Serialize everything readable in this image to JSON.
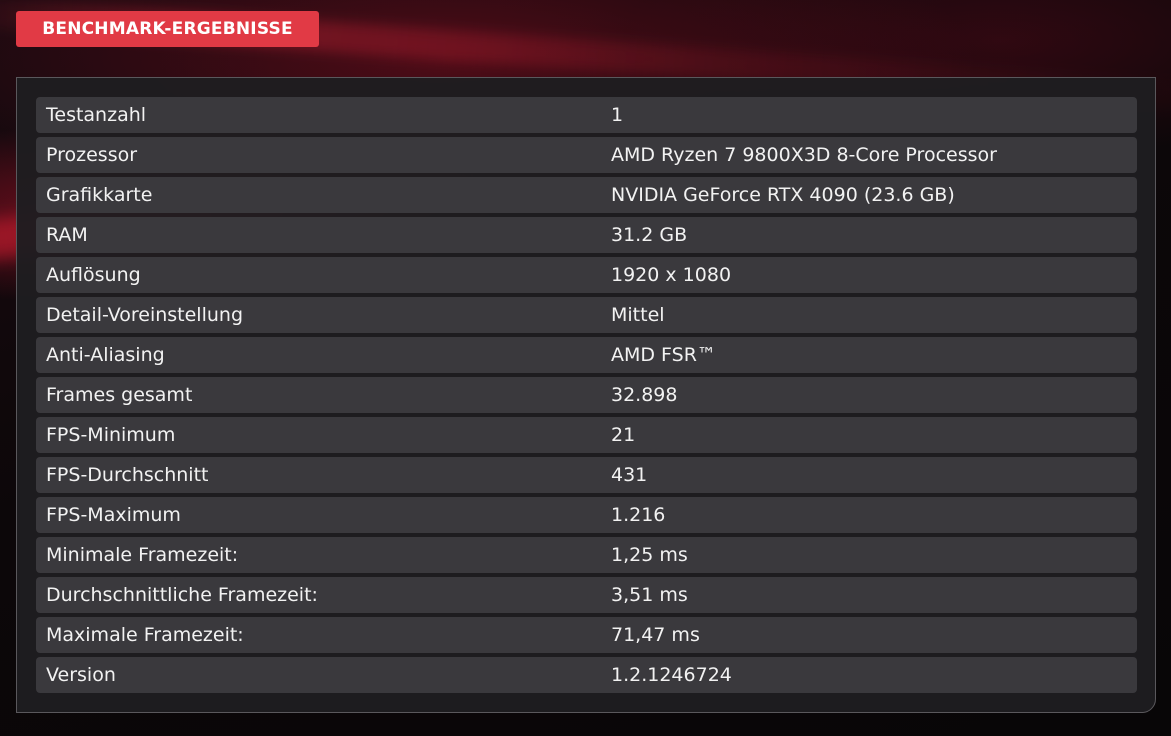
{
  "header": {
    "title": "BENCHMARK-ERGEBNISSE"
  },
  "results": [
    {
      "label": "Testanzahl",
      "value": "1"
    },
    {
      "label": "Prozessor",
      "value": "AMD Ryzen 7 9800X3D 8-Core Processor"
    },
    {
      "label": "Grafikkarte",
      "value": "NVIDIA GeForce RTX 4090 (23.6 GB)"
    },
    {
      "label": "RAM",
      "value": "31.2 GB"
    },
    {
      "label": "Auflösung",
      "value": "1920 x 1080"
    },
    {
      "label": "Detail-Voreinstellung",
      "value": "Mittel"
    },
    {
      "label": "Anti-Aliasing",
      "value": "AMD FSR™"
    },
    {
      "label": "Frames gesamt",
      "value": "32.898"
    },
    {
      "label": "FPS-Minimum",
      "value": "21"
    },
    {
      "label": "FPS-Durchschnitt",
      "value": "431"
    },
    {
      "label": "FPS-Maximum",
      "value": "1.216"
    },
    {
      "label": "Minimale Framezeit:",
      "value": "1,25 ms"
    },
    {
      "label": "Durchschnittliche Framezeit:",
      "value": "3,51 ms"
    },
    {
      "label": "Maximale Framezeit:",
      "value": "71,47 ms"
    },
    {
      "label": "Version",
      "value": "1.2.1246724"
    }
  ]
}
